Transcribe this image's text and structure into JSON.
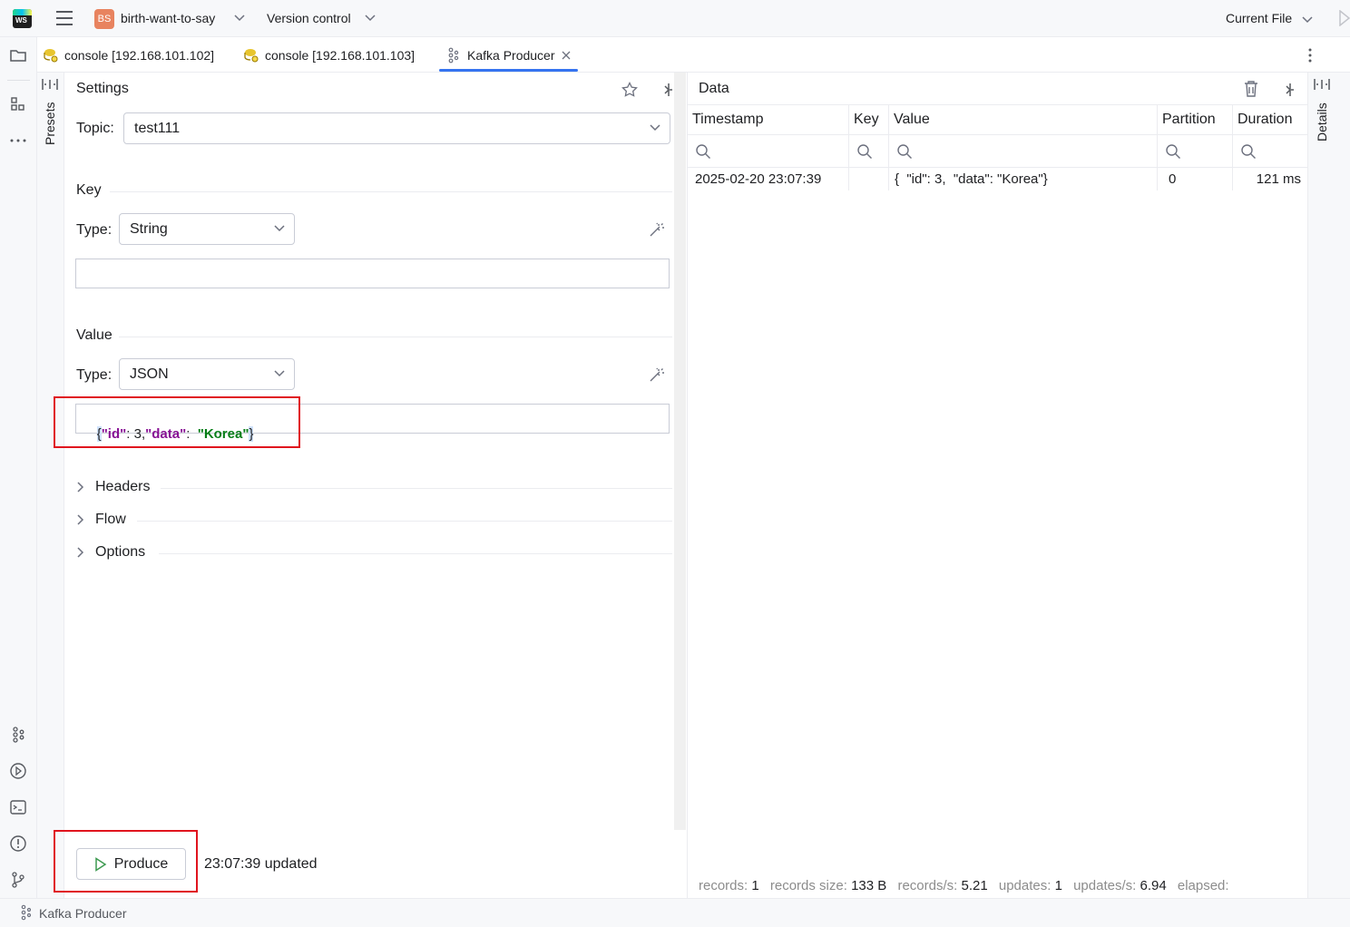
{
  "titlebar": {
    "app_logo": "WS",
    "project_badge": "BS",
    "project_name": "birth-want-to-say",
    "version_control": "Version control",
    "current_file": "Current File"
  },
  "tabs": [
    {
      "label": "console [192.168.101.102]",
      "icon": "db-console-icon"
    },
    {
      "label": "console [192.168.101.103]",
      "icon": "db-console-icon"
    },
    {
      "label": "Kafka Producer",
      "icon": "kafka-icon",
      "active": true
    }
  ],
  "presets_label": "Presets",
  "settings": {
    "title": "Settings",
    "topic_label": "Topic:",
    "topic_value": "test111",
    "key_section": "Key",
    "key_type_label": "Type:",
    "key_type_value": "String",
    "key_value": "",
    "value_section": "Value",
    "value_type_label": "Type:",
    "value_type_value": "JSON",
    "value_json": {
      "open": "{",
      "k1": "\"id\"",
      "colon1": ": ",
      "v1": "3",
      "comma": ",",
      "k2": "\"data\"",
      "colon2": ":  ",
      "v2": "\"Korea\"",
      "close": "}"
    },
    "sections": [
      "Headers",
      "Flow",
      "Options"
    ],
    "produce_button": "Produce",
    "updated_text": "23:07:39 updated"
  },
  "data_panel": {
    "title": "Data",
    "columns": [
      "Timestamp",
      "Key",
      "Value",
      "Partition",
      "Duration"
    ],
    "rows": [
      {
        "timestamp": "2025-02-20 23:07:39",
        "key": "",
        "value": "{  \"id\": 3,  \"data\": \"Korea\"}",
        "partition": "0",
        "duration": "121 ms"
      }
    ],
    "stats": {
      "records_label": "records:",
      "records": "1",
      "size_label": "records size:",
      "size": "133 B",
      "rps_label": "records/s:",
      "rps": "5.21",
      "updates_label": "updates:",
      "updates": "1",
      "ups_label": "updates/s:",
      "ups": "6.94",
      "elapsed_label": "elapsed:"
    }
  },
  "details_label": "Details",
  "statusbar": {
    "label": "Kafka Producer"
  },
  "colors": {
    "accent": "#3574f0",
    "highlight_box": "#e0141e",
    "produce_green": "#3d9a50"
  }
}
